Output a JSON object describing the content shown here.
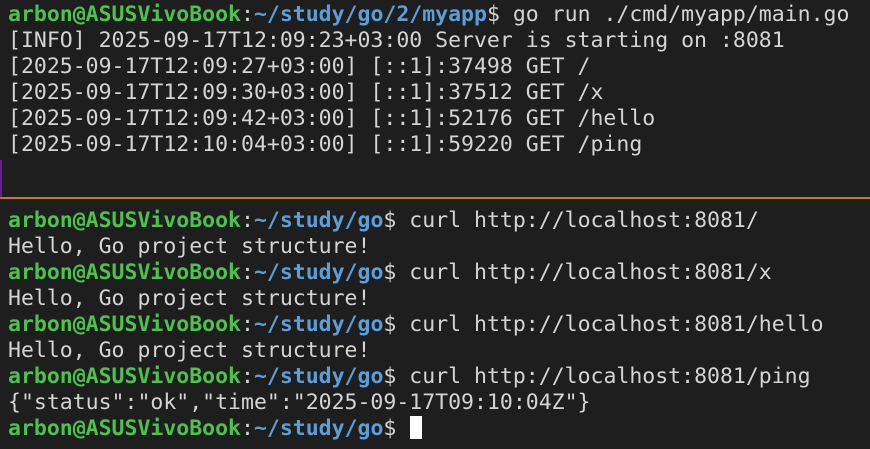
{
  "top_pane": {
    "prompt": {
      "user_host": "arbon@ASUSVivoBook",
      "colon": ":",
      "path": "~/study/go/2/myapp",
      "dollar": "$",
      "command": " go run ./cmd/myapp/main.go"
    },
    "output": [
      "[INFO] 2025-09-17T12:09:23+03:00 Server is starting on :8081",
      "[2025-09-17T12:09:27+03:00] [::1]:37498 GET /",
      "[2025-09-17T12:09:30+03:00] [::1]:37512 GET /x",
      "[2025-09-17T12:09:42+03:00] [::1]:52176 GET /hello",
      "[2025-09-17T12:10:04+03:00] [::1]:59220 GET /ping"
    ]
  },
  "bottom_pane": {
    "entries": [
      {
        "user_host": "arbon@ASUSVivoBook",
        "colon": ":",
        "path": "~/study/go",
        "dollar": "$",
        "command": " curl http://localhost:8081/",
        "output": "Hello, Go project structure!"
      },
      {
        "user_host": "arbon@ASUSVivoBook",
        "colon": ":",
        "path": "~/study/go",
        "dollar": "$",
        "command": " curl http://localhost:8081/x",
        "output": "Hello, Go project structure!"
      },
      {
        "user_host": "arbon@ASUSVivoBook",
        "colon": ":",
        "path": "~/study/go",
        "dollar": "$",
        "command": " curl http://localhost:8081/hello",
        "output": "Hello, Go project structure!"
      },
      {
        "user_host": "arbon@ASUSVivoBook",
        "colon": ":",
        "path": "~/study/go",
        "dollar": "$",
        "command": " curl http://localhost:8081/ping",
        "output": "{\"status\":\"ok\",\"time\":\"2025-09-17T09:10:04Z\"}"
      }
    ],
    "current_prompt": {
      "user_host": "arbon@ASUSVivoBook",
      "colon": ":",
      "path": "~/study/go",
      "dollar": "$"
    }
  },
  "colors": {
    "background": "#1e1e1e",
    "user_host": "#4ec24e",
    "path": "#5c9fd8",
    "text": "#d4d4d4",
    "divider": "#c27d1a",
    "cursor": "#ffffff"
  }
}
